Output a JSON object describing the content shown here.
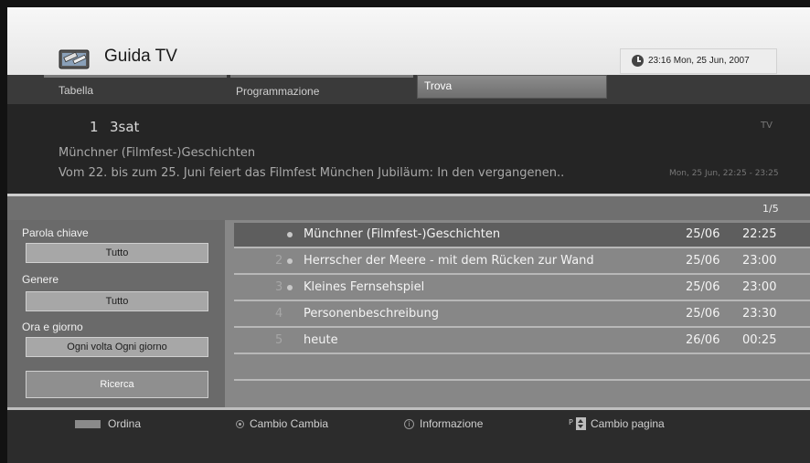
{
  "header": {
    "title": "Guida TV",
    "icon": "tv-remote-icon",
    "clock": "23:16 Mon, 25 Jun, 2007"
  },
  "tabs": {
    "tabella": "Tabella",
    "programmazione": "Programmazione",
    "trova": "Trova"
  },
  "info": {
    "channel_number": "1",
    "channel_name": "3sat",
    "type": "TV",
    "program_title": "Münchner (Filmfest-)Geschichten",
    "program_desc": "Vom 22. bis zum 25. Juni feiert das Filmfest München Jubiläum: In den vergangenen..",
    "program_time": "Mon, 25 Jun, 22:25 - 23:25"
  },
  "page_indicator": "1/5",
  "filters": {
    "keyword_label": "Parola chiave",
    "keyword_value": "Tutto",
    "genre_label": "Genere",
    "genre_value": "Tutto",
    "time_label": "Ora e giorno",
    "time_value": "Ogni volta  Ogni giorno",
    "search_button": "Ricerca"
  },
  "results": [
    {
      "num": "",
      "name": "Münchner (Filmfest-)Geschichten",
      "date": "25/06",
      "time": "22:25"
    },
    {
      "num": "2",
      "name": "Herrscher der Meere - mit dem Rücken zur Wand",
      "date": "25/06",
      "time": "23:00"
    },
    {
      "num": "3",
      "name": "Kleines Fernsehspiel",
      "date": "25/06",
      "time": "23:00"
    },
    {
      "num": "4",
      "name": "Personenbeschreibung",
      "date": "25/06",
      "time": "23:30"
    },
    {
      "num": "5",
      "name": "heute",
      "date": "26/06",
      "time": "00:25"
    }
  ],
  "footer": {
    "ordina": "Ordina",
    "cambio": "Cambio Cambia",
    "informazione": "Informazione",
    "p_key": "P",
    "cambio_pagina": "Cambio pagina"
  },
  "colors": {
    "header_bg": "#efefef",
    "selected_row": "#5e5e5e",
    "list_bg": "#878787",
    "panel_bg": "#6a6a6a"
  }
}
